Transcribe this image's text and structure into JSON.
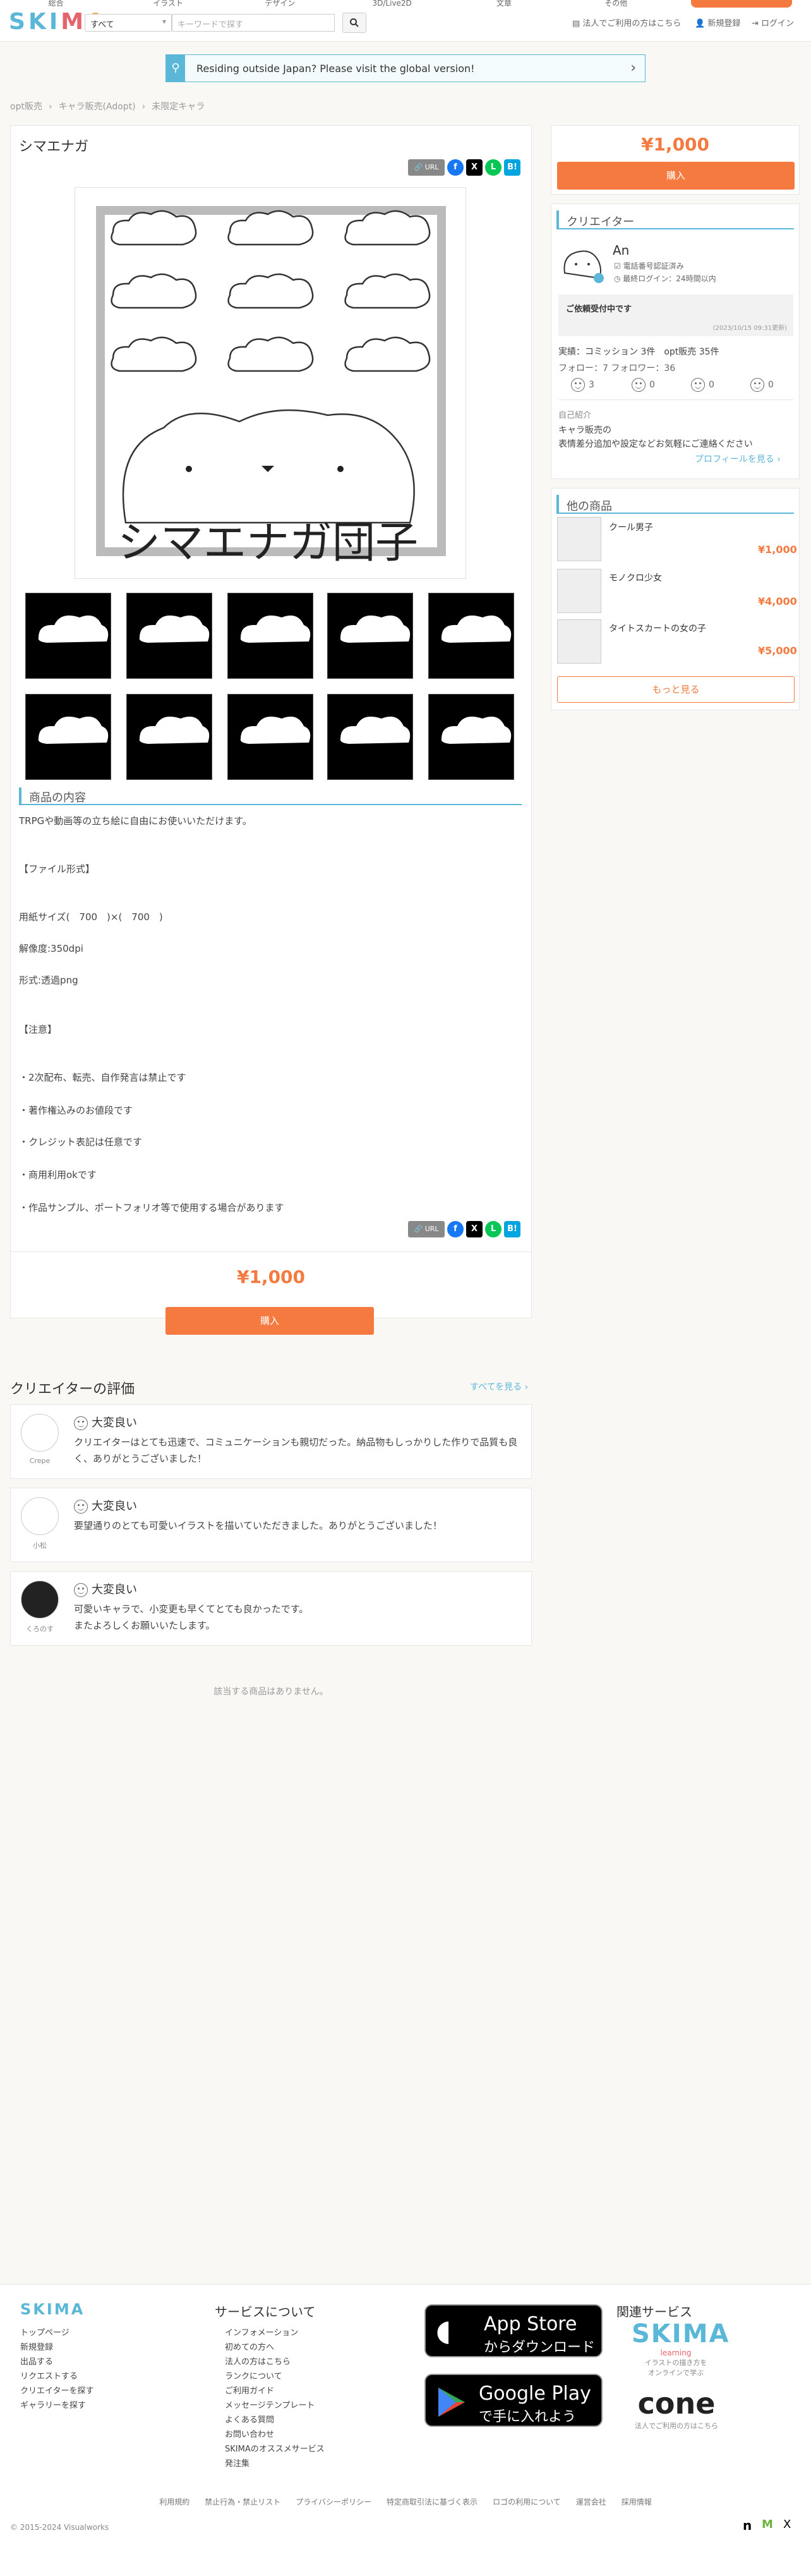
{
  "header": {
    "nav_items": [
      "総合",
      "イラスト",
      "デザイン",
      "3D/Live2D",
      "文章",
      "その他"
    ],
    "logo": [
      "S",
      "K",
      "I",
      "M",
      "A"
    ],
    "category_select": "すべて",
    "search_placeholder": "キーワードで探す",
    "corporate_link": "法人でご利用の方はこちら",
    "register_link": "新規登録",
    "login_link": "ログイン"
  },
  "banner": {
    "text": "Residing outside Japan? Please visit the global version!"
  },
  "breadcrumb": [
    "opt販売",
    "キャラ販売(Adopt)",
    "未限定キャラ"
  ],
  "product": {
    "title": "シマエナガ",
    "url_label": "URL",
    "image_caption": "シマエナガ団子",
    "section_title": "商品の内容",
    "description": [
      "TRPGや動画等の立ち絵に自由にお使いいただけます。",
      "【ファイル形式】",
      "用紙サイズ(　700　)×(　700　)",
      "解像度:350dpi",
      "形式:透過png",
      "【注意】",
      "・2次配布、転売、自作発言は禁止です",
      "・著作権込みのお値段です",
      "・クレジット表記は任意です",
      "・商用利用okです",
      "・作品サンプル、ポートフォリオ等で使用する場合があります"
    ],
    "price": "¥1,000",
    "buy_label": "購入"
  },
  "creator": {
    "section_title": "クリエイター",
    "name": "An",
    "verified": "電話番号認証済み",
    "last_login": "最終ログイン：24時間以内",
    "request_status": "ご依頼受付中です",
    "request_date": "(2023/10/15 09:31更新)",
    "stats": "実績：コミッション 3件　opt販売 35件",
    "follow": "フォロー：7 フォロワー：36",
    "evals": [
      "3",
      "0",
      "0",
      "0"
    ],
    "intro_label": "自己紹介",
    "intro_lines": [
      "キャラ販売の",
      "表情差分追加や設定などお気軽にご連絡ください"
    ],
    "profile_link": "プロフィールを見る ›"
  },
  "other_products": {
    "title": "他の商品",
    "items": [
      {
        "name": "クール男子",
        "price": "¥1,000"
      },
      {
        "name": "モノクロ少女",
        "price": "¥4,000"
      },
      {
        "name": "タイトスカートの女の子",
        "price": "¥5,000"
      }
    ],
    "more_label": "もっと見る"
  },
  "reviews": {
    "title": "クリエイターの評価",
    "see_all": "すべてを見る ›",
    "items": [
      {
        "user": "Crepe",
        "rating": "大変良い",
        "comment": "クリエイターはとても迅速で、コミュニケーションも親切だった。納品物もしっかりした作りで品質も良く、ありがとうございました！"
      },
      {
        "user": "小松",
        "rating": "大変良い",
        "comment": "要望通りのとても可愛いイラストを描いていただきました。ありがとうございました！"
      },
      {
        "user": "くろのす",
        "rating": "大変良い",
        "comment": "可愛いキャラで、小変更も早くてとても良かったです。\nまたよろしくお願いいたします。"
      }
    ]
  },
  "no_items": "該当する商品はありません。",
  "footer": {
    "logo": "SKIMA",
    "col1": [
      "トップページ",
      "新規登録",
      "出品する",
      "リクエストする",
      "クリエイターを探す",
      "ギャラリーを探す"
    ],
    "services_title": "サービスについて",
    "col2": [
      "インフォメーション",
      "初めての方へ",
      "法人の方はこちら",
      "ランクについて",
      "ご利用ガイド",
      "メッセージテンプレート",
      "よくある質問",
      "お問い合わせ",
      "SKIMAのオススメサービス",
      "発注集"
    ],
    "appstore_small": "App Store",
    "appstore_big": "からダウンロード",
    "googleplay_small": "Google Play",
    "googleplay_big": "で手に入れよう",
    "related_title": "関連サービス",
    "skima_learning": "SKIMA",
    "learning_sub": "learning",
    "learning_desc": [
      "イラストの描き方を",
      "オンラインで学ぶ"
    ],
    "cone": "cone",
    "cone_desc": "法人でご利用の方はこちら",
    "bottom_links": [
      "利用規約",
      "禁止行為・禁止リスト",
      "プライバシーポリシー",
      "特定商取引法に基づく表示",
      "ロゴの利用について",
      "運営会社",
      "採用情報"
    ],
    "copyright": "© 2015-2024 Visualworks"
  },
  "colors": {
    "accent": "#f47a3f",
    "brand": "#5bb7d8"
  }
}
